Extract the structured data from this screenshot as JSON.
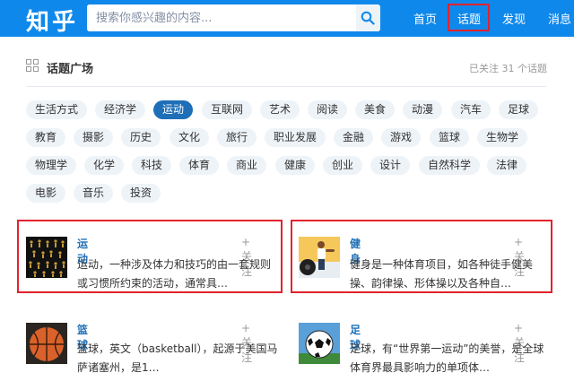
{
  "header": {
    "logo": "知乎",
    "search_placeholder": "搜索你感兴趣的内容...",
    "nav": [
      "首页",
      "话题",
      "发现",
      "消息"
    ],
    "active_nav": "话题"
  },
  "panel": {
    "title": "话题广场",
    "follow_count": "已关注 31 个话题"
  },
  "tags": [
    [
      "生活方式",
      "经济学",
      "运动",
      "互联网",
      "艺术",
      "阅读",
      "美食",
      "动漫",
      "汽车",
      "足球"
    ],
    [
      "教育",
      "摄影",
      "历史",
      "文化",
      "旅行",
      "职业发展",
      "金融",
      "游戏",
      "篮球",
      "生物学"
    ],
    [
      "物理学",
      "化学",
      "科技",
      "体育",
      "商业",
      "健康",
      "创业",
      "设计",
      "自然科学",
      "法律"
    ],
    [
      "电影",
      "音乐",
      "投资"
    ]
  ],
  "active_tag": "运动",
  "cards": [
    {
      "title": "运动",
      "follow": "+ 关注",
      "desc": "运动，一种涉及体力和技巧的由一套规则或习惯所约束的活动，通常具…"
    },
    {
      "title": "健身",
      "follow": "+ 关注",
      "desc": "健身是一种体育项目，如各种徒手健美操、韵律操、形体操以及各种自…"
    },
    {
      "title": "篮球",
      "follow": "+ 关注",
      "desc": "篮球，英文（basketball），起源于美国马萨诸塞州，是1…"
    },
    {
      "title": "足球",
      "follow": "+ 关注",
      "desc": "足球，有“世界第一运动”的美誉，是全球体育界最具影响力的单项体…"
    }
  ],
  "colors": {
    "header_bg": "#0f88eb",
    "link": "#1e6fb8",
    "highlight": "#e0232e",
    "tag_bg": "#eef3f8"
  }
}
